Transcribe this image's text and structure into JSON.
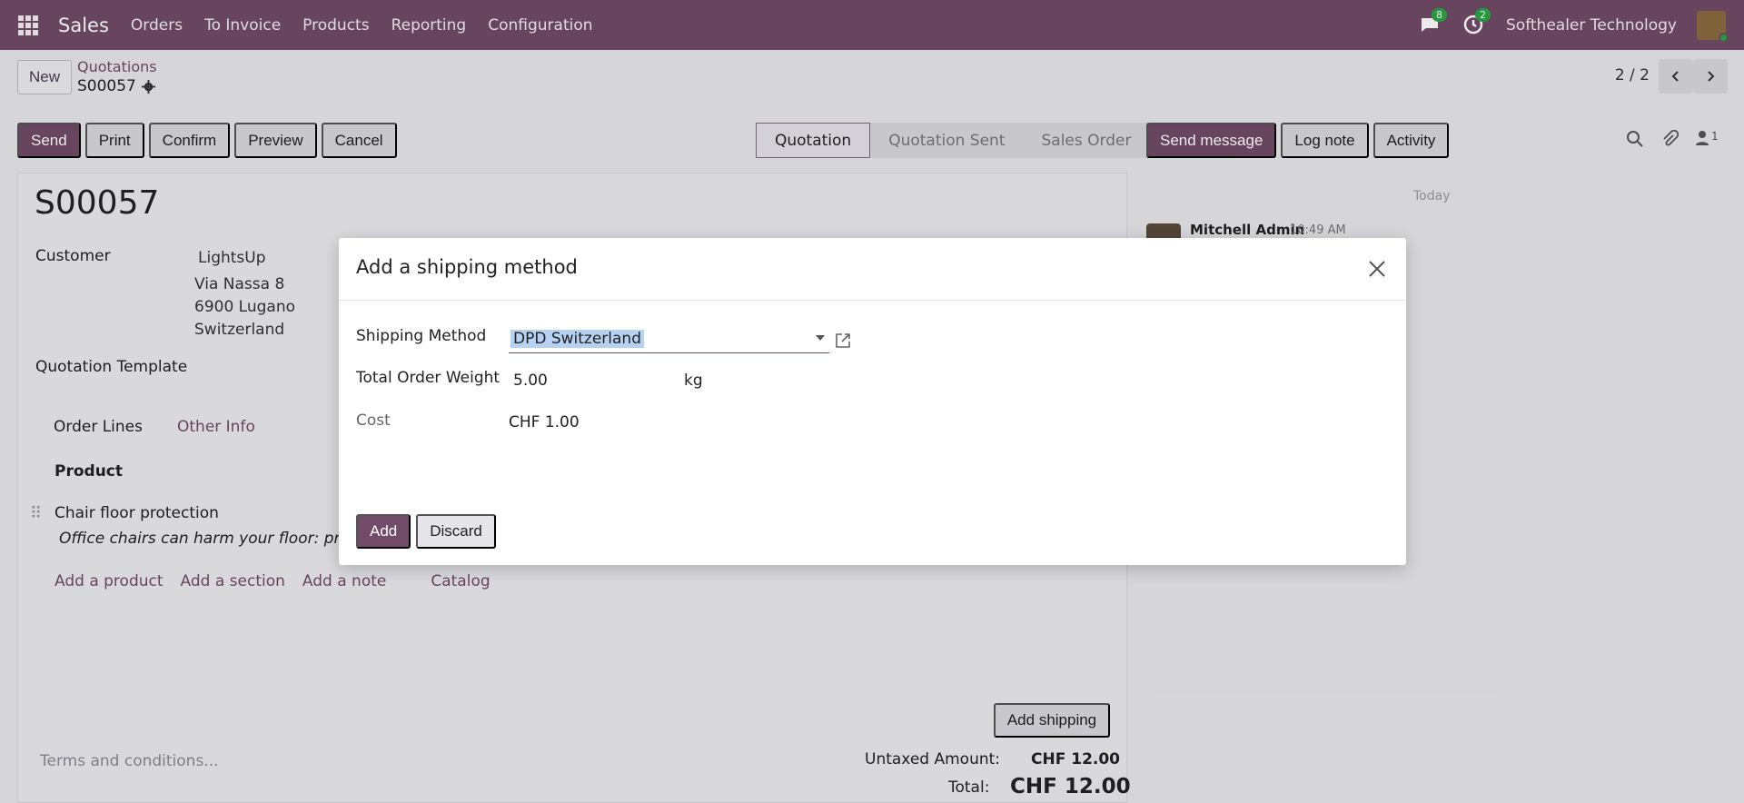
{
  "topbar": {
    "app_name": "Sales",
    "nav": [
      "Orders",
      "To Invoice",
      "Products",
      "Reporting",
      "Configuration"
    ],
    "messages_count": "8",
    "activities_count": "2",
    "company": "Softhealer Technology"
  },
  "control_panel": {
    "new_label": "New",
    "breadcrumb_parent": "Quotations",
    "breadcrumb_current": "S00057",
    "pager": "2 / 2"
  },
  "actions": {
    "send": "Send",
    "print": "Print",
    "confirm": "Confirm",
    "preview": "Preview",
    "cancel": "Cancel"
  },
  "statusbar": [
    "Quotation",
    "Quotation Sent",
    "Sales Order"
  ],
  "chatter": {
    "send_message": "Send message",
    "log_note": "Log note",
    "activity": "Activity",
    "followers_count": "1",
    "date_separator": "Today",
    "message_author": "Mitchell Admin",
    "message_time": "10:49 AM"
  },
  "form": {
    "title": "S00057",
    "customer_label": "Customer",
    "customer_name": "LightsUp",
    "address_line1": "Via Nassa 8",
    "address_line2": "6900 Lugano",
    "address_line3": "Switzerland",
    "template_label": "Quotation Template",
    "tab_order_lines": "Order Lines",
    "tab_other_info": "Other Info",
    "col_product": "Product",
    "product_name": "Chair floor protection",
    "product_desc": "Office chairs can harm your floor: protec",
    "add_product": "Add a product",
    "add_section": "Add a section",
    "add_note": "Add a note",
    "catalog": "Catalog",
    "add_shipping": "Add shipping",
    "terms_placeholder": "Terms and conditions...",
    "untaxed_label": "Untaxed Amount:",
    "untaxed_value": "CHF 12.00",
    "total_label": "Total:",
    "total_value": "CHF 12.00"
  },
  "modal": {
    "title": "Add a shipping method",
    "shipping_method_label": "Shipping Method",
    "shipping_method_value": "DPD Switzerland",
    "weight_label": "Total Order Weight",
    "weight_value": "5.00",
    "weight_unit": "kg",
    "cost_label": "Cost",
    "cost_value": "CHF 1.00",
    "add_button": "Add",
    "discard_button": "Discard"
  },
  "colors": {
    "brand": "#714b67",
    "badge": "#28a745"
  }
}
